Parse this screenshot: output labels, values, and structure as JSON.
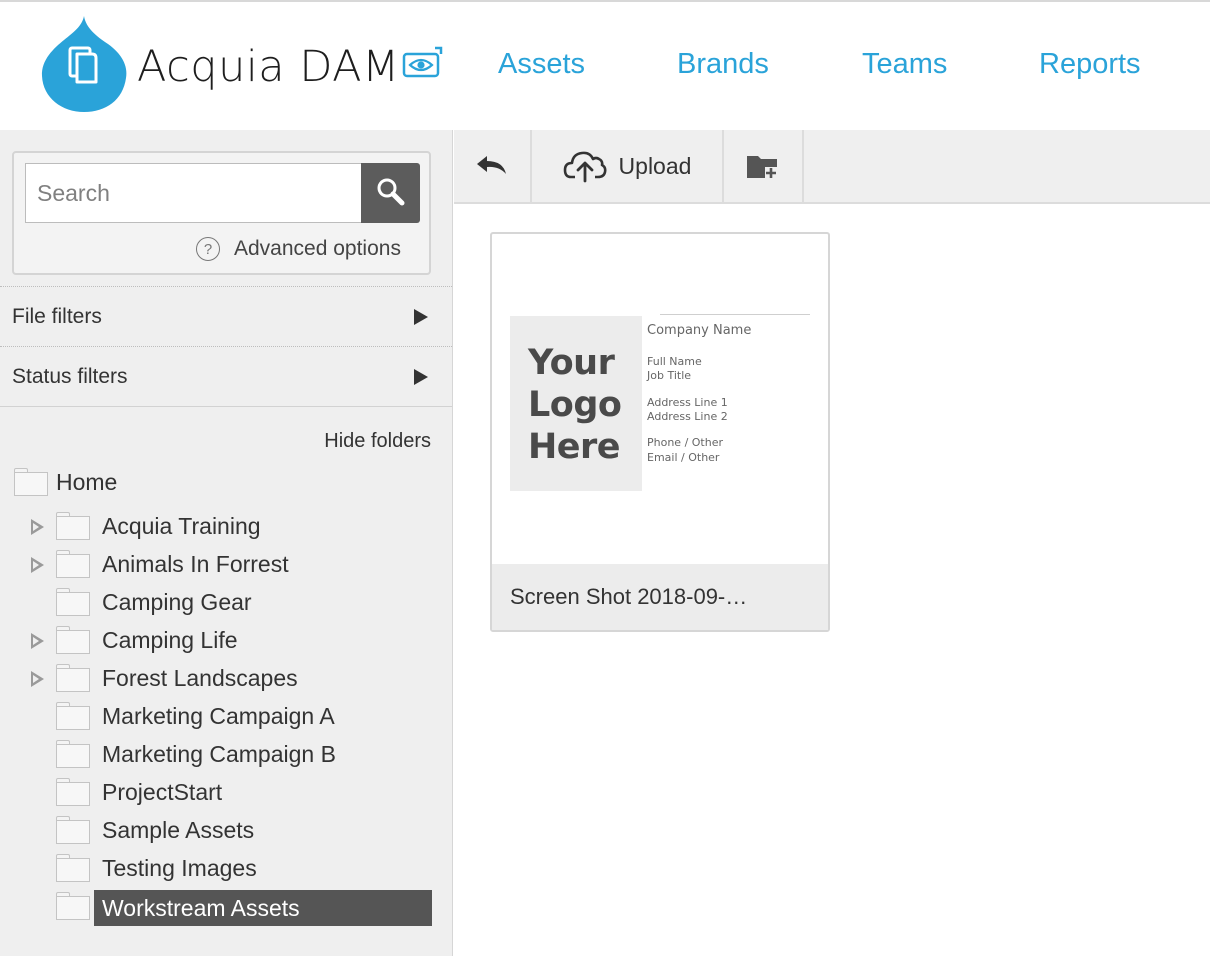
{
  "app": {
    "name": "Acquia DAM",
    "brand_color": "#2aa3d9"
  },
  "nav": {
    "items": [
      {
        "label": "Assets"
      },
      {
        "label": "Brands"
      },
      {
        "label": "Teams"
      },
      {
        "label": "Reports"
      }
    ]
  },
  "search": {
    "placeholder": "Search",
    "value": "",
    "advanced_label": "Advanced options",
    "help_glyph": "?"
  },
  "filters": [
    {
      "label": "File filters"
    },
    {
      "label": "Status filters"
    }
  ],
  "folders": {
    "toggle_label": "Hide folders",
    "root": {
      "label": "Home"
    },
    "items": [
      {
        "label": "Acquia Training",
        "expandable": true,
        "selected": false
      },
      {
        "label": "Animals In Forrest",
        "expandable": true,
        "selected": false
      },
      {
        "label": "Camping Gear",
        "expandable": false,
        "selected": false
      },
      {
        "label": "Camping Life",
        "expandable": true,
        "selected": false
      },
      {
        "label": "Forest Landscapes",
        "expandable": true,
        "selected": false
      },
      {
        "label": "Marketing Campaign A",
        "expandable": false,
        "selected": false
      },
      {
        "label": "Marketing Campaign B",
        "expandable": false,
        "selected": false
      },
      {
        "label": "ProjectStart",
        "expandable": false,
        "selected": false
      },
      {
        "label": "Sample Assets",
        "expandable": false,
        "selected": false
      },
      {
        "label": "Testing Images",
        "expandable": false,
        "selected": false
      },
      {
        "label": "Workstream Assets",
        "expandable": false,
        "selected": true
      }
    ]
  },
  "toolbar": {
    "back_icon": "back-arrow-icon",
    "upload_label": "Upload",
    "upload_icon": "cloud-upload-icon",
    "new_folder_icon": "new-folder-icon"
  },
  "assets": [
    {
      "title": "Screen Shot 2018-09-…",
      "thumbnail": {
        "logo_lines": [
          "Your",
          "Logo",
          "Here"
        ],
        "company": "Company Name",
        "name_lines": [
          "Full Name",
          "Job Title"
        ],
        "address_lines": [
          "Address Line 1",
          "Address Line 2"
        ],
        "contact_lines": [
          "Phone / Other",
          "Email / Other"
        ]
      }
    }
  ]
}
